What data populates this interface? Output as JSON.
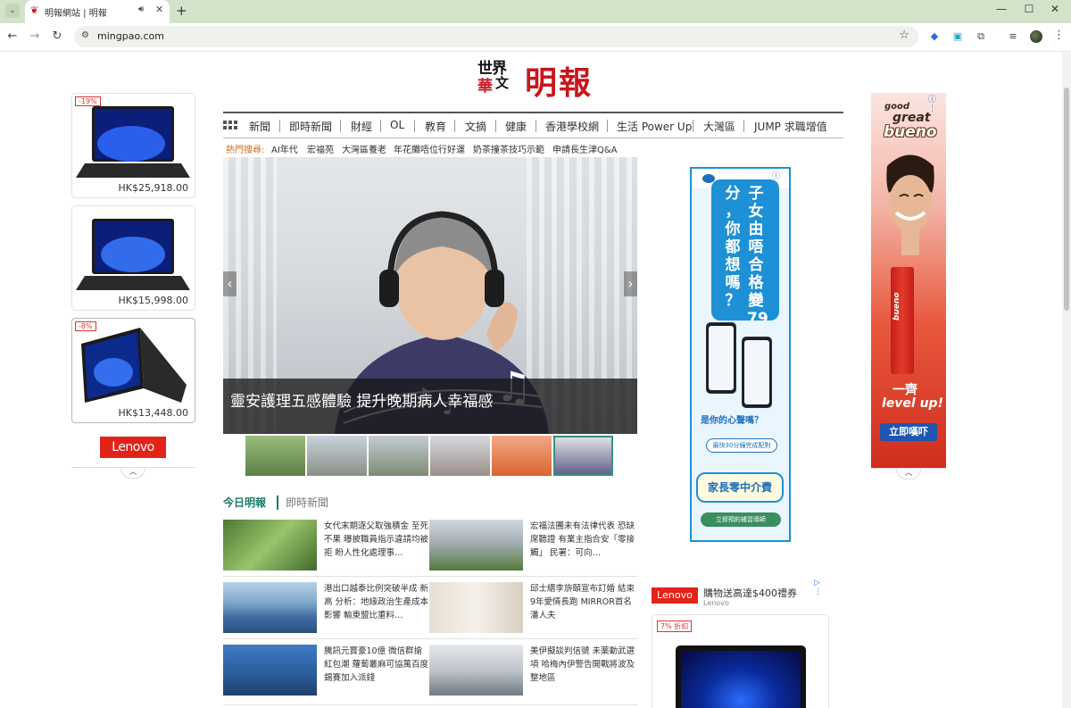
{
  "browser": {
    "tab_title": "明報網站 | 明報",
    "url": "mingpao.com",
    "icons": [
      "tab-search-icon",
      "audio-icon",
      "close-icon",
      "plus-icon",
      "minimize-icon",
      "maximize-icon",
      "window-close-icon",
      "back-icon",
      "forward-icon",
      "reload-icon",
      "site-info-icon",
      "star-icon",
      "extension-icon",
      "menu-icon"
    ]
  },
  "logo": {
    "world_top": "世界",
    "world_left": "華",
    "world_right": "文",
    "mingpao": "明報"
  },
  "nav": {
    "items": [
      "新聞",
      "即時新聞",
      "財經",
      "OL",
      "教育",
      "文摘",
      "健康",
      "香港學校網",
      "生活 Power Up",
      "大灣區",
      "JUMP 求職增值"
    ]
  },
  "hot_search": {
    "label": "熱門搜尋:",
    "items": [
      "AI年代",
      "宏福苑",
      "大灣區養老",
      "年花攤唔位行好運",
      "奶茶撞茶技巧示範",
      "申請長生津Q&A"
    ]
  },
  "hero": {
    "caption": "靈安護理五感體驗 提升晚期病人幸福感",
    "prev": "‹",
    "next": "›"
  },
  "news_tabs": {
    "active": "今日明報",
    "other": "即時新聞"
  },
  "stories": [
    {
      "text": "女代末期逐父取強積金 至死不果 曝披職員指示違請均被拒 盼人性化處理事…"
    },
    {
      "text": "宏福法團未有法律代表 恐缺席聽證 有業主指合安「零接觸」 民署：可向…"
    },
    {
      "text": "港出口越泰比例突破半成 新高 分析：地緣政治生產成本影響 輸東盟比重料…"
    },
    {
      "text": "邱士縉李旂頤宣布訂婚 結束9年愛情長跑 MIRROR首名潘人夫"
    },
    {
      "text": "騰訊元寶豪10億 微信群搶紅包潮 蘿蔔叢麻可協萬百度錫賽加入派錢"
    },
    {
      "text": "美伊擬談判信號 未薬動武選項 哈梅內伊警告開戰將波及整地區"
    }
  ],
  "left_ad": {
    "products": [
      {
        "discount": "-19%",
        "price": "HK$25,918.00"
      },
      {
        "discount": "",
        "price": "HK$15,998.00"
      },
      {
        "discount": "-8%",
        "price": "HK$13,448.00"
      }
    ],
    "brand": "Lenovo",
    "collapse": "︿",
    "info": "ⓘ ⋮"
  },
  "mid_ad": {
    "col1": [
      "子",
      "女",
      "由",
      "唔",
      "合",
      "格",
      "變",
      "79"
    ],
    "col2": [
      "分",
      "，",
      "你",
      "都",
      "想",
      "嗎",
      "？"
    ],
    "question": "是你的心聲嗎？",
    "pill": "最快30分鐘完成配對",
    "bubble": "家長零中介費",
    "cta": "立即預約補習導師",
    "info": "ⓘ ✕"
  },
  "right_ad": {
    "good": "good",
    "great": "great",
    "bueno": "bueno",
    "bar": "bueno",
    "yi": "一齊",
    "level": "level up!",
    "cta": "立即嘆吓",
    "collapse": "︿",
    "info": "ⓘ ⋮"
  },
  "br_ad": {
    "brand": "Lenovo",
    "title": "購物送高達$400禮券",
    "subtitle": "Lenovo",
    "discount": "7% 折扣",
    "info": "▷ ⋮"
  },
  "colors": {
    "brand_red": "#c8161d",
    "accent_teal": "#1a7a6a",
    "hot_orange": "#d2691e",
    "lenovo_red": "#e2231a"
  }
}
